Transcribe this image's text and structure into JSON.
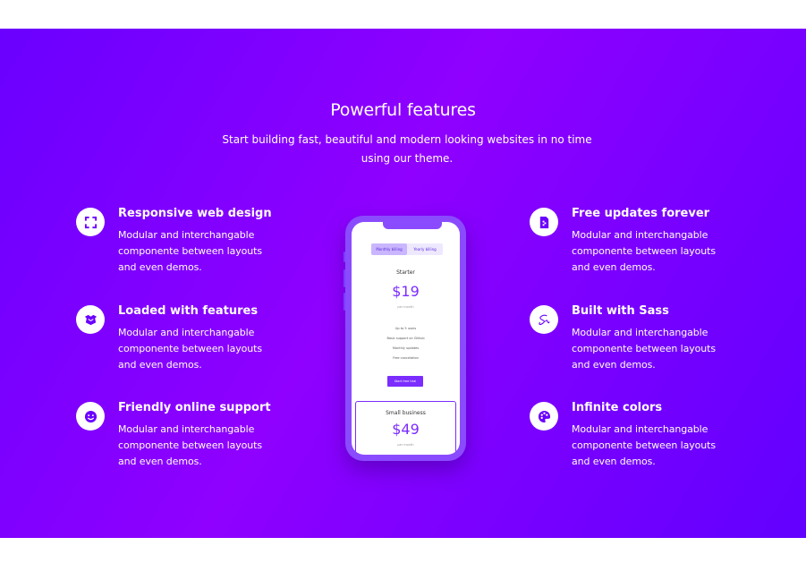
{
  "section": {
    "title": "Powerful features",
    "subtitle": "Start building fast, beautiful and modern looking websites in no time using our theme."
  },
  "features_left": [
    {
      "icon": "expand-icon",
      "title": "Responsive web design",
      "desc": "Modular and interchangable componente between layouts and even demos."
    },
    {
      "icon": "box-icon",
      "title": "Loaded with features",
      "desc": "Modular and interchangable componente between layouts and even demos."
    },
    {
      "icon": "smile-icon",
      "title": "Friendly online support",
      "desc": "Modular and interchangable componente between layouts and even demos."
    }
  ],
  "features_right": [
    {
      "icon": "file-icon",
      "title": "Free updates forever",
      "desc": "Modular and interchangable componente between layouts and even demos."
    },
    {
      "icon": "sass-icon",
      "title": "Built with Sass",
      "desc": "Modular and interchangable componente between layouts and even demos."
    },
    {
      "icon": "palette-icon",
      "title": "Infinite colors",
      "desc": "Modular and interchangable componente between layouts and even demos."
    }
  ],
  "phone": {
    "toggle_monthly": "Monthly billing",
    "toggle_yearly": "Yearly billing",
    "plan1": {
      "name": "Starter",
      "price": "$19",
      "per": "per month",
      "features": [
        "Up to 5 users",
        "Basic support on Github",
        "Monthly updates",
        "Free cancelation"
      ],
      "button": "Start free trial"
    },
    "plan2": {
      "name": "Small business",
      "price": "$49",
      "per": "per month"
    }
  },
  "colors": {
    "gradient_start": "#6a00ff",
    "gradient_mid": "#8f00ff",
    "accent": "#7b2cff",
    "icon_color": "#6a00ff"
  }
}
